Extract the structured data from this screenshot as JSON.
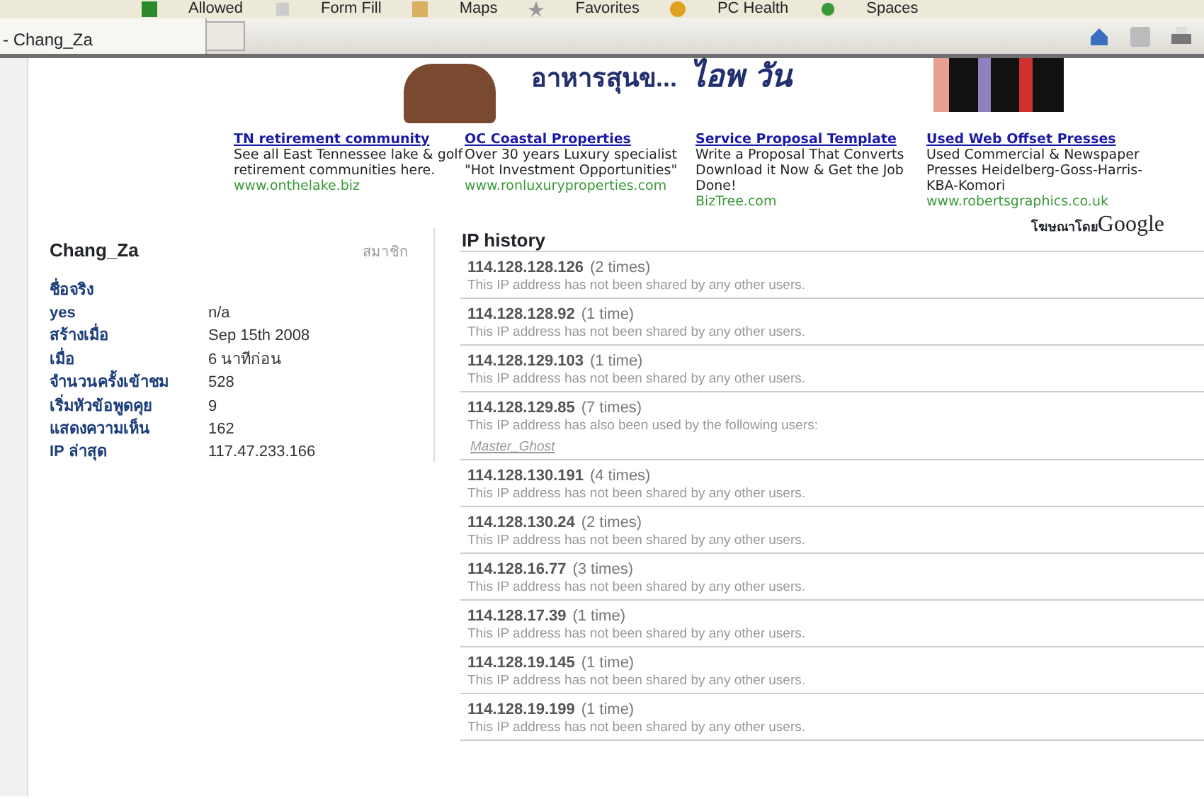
{
  "toolbar": {
    "items": [
      {
        "label": "Allowed"
      },
      {
        "label": "Form Fill"
      },
      {
        "label": "Maps"
      },
      {
        "label": "Favorites"
      },
      {
        "label": "PC Health"
      },
      {
        "label": "Spaces"
      }
    ]
  },
  "tab": {
    "title": "- Chang_Za"
  },
  "banner": {
    "headline": "อาหารสุนข...",
    "brand": "ไอพ วัน"
  },
  "ads": [
    {
      "title": "TN retirement community",
      "text": "See all East Tennessee lake & golf retirement communities here.",
      "url": "www.onthelake.biz"
    },
    {
      "title": "OC Coastal Properties",
      "text": "Over 30 years Luxury specialist \"Hot Investment Opportunities\"",
      "url": "www.ronluxuryproperties.com"
    },
    {
      "title": "Service Proposal Template",
      "text": "Write a Proposal That Converts Download it Now & Get the Job Done!",
      "url": "BizTree.com"
    },
    {
      "title": "Used Web Offset Presses",
      "text": "Used Commercial & Newspaper Presses Heidelberg-Goss-Harris-KBA-Komori",
      "url": "www.robertsgraphics.co.uk"
    }
  ],
  "ads_by": {
    "prefix": "โฆษณาโดย",
    "brand": "Google"
  },
  "profile": {
    "username": "Chang_Za",
    "role": "สมาชิก",
    "fields": [
      {
        "label": "ชื่อจริง"
      },
      {
        "label": "yes",
        "value": "n/a"
      },
      {
        "label": "สร้างเมื่อ",
        "value": "Sep 15th 2008"
      },
      {
        "label": "เมื่อ",
        "value": "6 นาทีก่อน"
      },
      {
        "label": "จำนวนครั้งเข้าชม",
        "value": "528"
      },
      {
        "label": "เริ่มหัวข้อพูดคุย",
        "value": "9"
      },
      {
        "label": "แสดงความเห็น",
        "value": "162"
      },
      {
        "label": "IP ล่าสุด",
        "value": "117.47.233.166"
      }
    ]
  },
  "ip_history": {
    "title": "IP history",
    "entries": [
      {
        "ip": "114.128.128.126",
        "count": "(2 times)",
        "note": "This IP address has not been shared by any other users."
      },
      {
        "ip": "114.128.128.92",
        "count": "(1 time)",
        "note": "This IP address has not been shared by any other users."
      },
      {
        "ip": "114.128.129.103",
        "count": "(1 time)",
        "note": "This IP address has not been shared by any other users."
      },
      {
        "ip": "114.128.129.85",
        "count": "(7 times)",
        "note": "This IP address has also been used by the following users:",
        "users": [
          "Master_Ghost"
        ]
      },
      {
        "ip": "114.128.130.191",
        "count": "(4 times)",
        "note": "This IP address has not been shared by any other users."
      },
      {
        "ip": "114.128.130.24",
        "count": "(2 times)",
        "note": "This IP address has not been shared by any other users."
      },
      {
        "ip": "114.128.16.77",
        "count": "(3 times)",
        "note": "This IP address has not been shared by any other users."
      },
      {
        "ip": "114.128.17.39",
        "count": "(1 time)",
        "note": "This IP address has not been shared by any other users."
      },
      {
        "ip": "114.128.19.145",
        "count": "(1 time)",
        "note": "This IP address has not been shared by any other users."
      },
      {
        "ip": "114.128.19.199",
        "count": "(1 time)",
        "note": "This IP address has not been shared by any other users."
      }
    ]
  }
}
